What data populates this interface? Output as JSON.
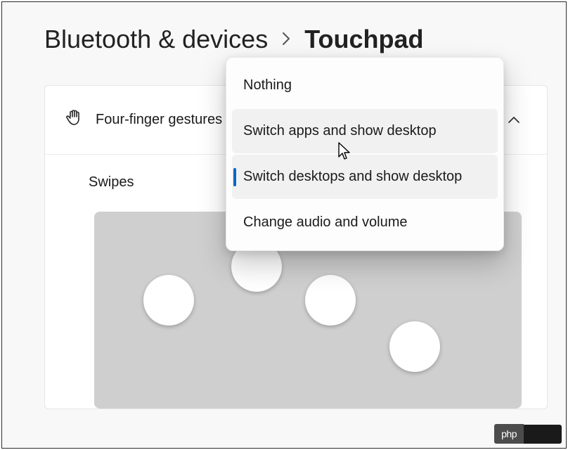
{
  "breadcrumb": {
    "parent": "Bluetooth & devices",
    "current": "Touchpad"
  },
  "card": {
    "title": "Four-finger gestures",
    "swipes_label": "Swipes"
  },
  "menu": {
    "items": [
      {
        "label": "Nothing",
        "state": "normal"
      },
      {
        "label": "Switch apps and show desktop",
        "state": "hovered"
      },
      {
        "label": "Switch desktops and show desktop",
        "state": "selected"
      },
      {
        "label": "Change audio and volume",
        "state": "normal"
      }
    ]
  },
  "watermark": {
    "text": "php"
  }
}
